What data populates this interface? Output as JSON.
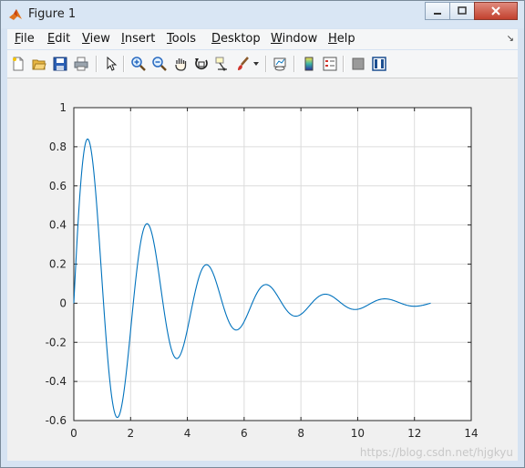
{
  "window": {
    "title": "Figure 1"
  },
  "menu": [
    {
      "id": "file",
      "label": "File"
    },
    {
      "id": "edit",
      "label": "Edit"
    },
    {
      "id": "view",
      "label": "View"
    },
    {
      "id": "insert",
      "label": "Insert"
    },
    {
      "id": "tools",
      "label": "Tools"
    },
    {
      "id": "desktop",
      "label": "Desktop"
    },
    {
      "id": "window",
      "label": "Window"
    },
    {
      "id": "help",
      "label": "Help"
    }
  ],
  "toolbar": [
    "new-figure-icon",
    "open-file-icon",
    "save-icon",
    "print-icon",
    "select-arrow-icon",
    "zoom-in-icon",
    "zoom-out-icon",
    "pan-hand-icon",
    "rotate-3d-icon",
    "data-cursor-icon",
    "brush-icon",
    "link-plot-icon",
    "colorbar-icon",
    "legend-icon",
    "hide-plot-tools-icon",
    "show-plot-tools-icon"
  ],
  "colors": {
    "line": "#0072bd",
    "grid": "#dcdcdc",
    "axes_bg": "#ffffff",
    "figure_bg": "#f0f0f0"
  },
  "chart_data": {
    "type": "line",
    "function": "damped sinusoid, amplitude ~0.85 decaying, period ~2.1",
    "x_range": [
      0,
      12.57
    ],
    "xlim": [
      0,
      14
    ],
    "ylim": [
      -0.6,
      1
    ],
    "xticks": [
      "0",
      "2",
      "4",
      "6",
      "8",
      "10",
      "12",
      "14"
    ],
    "yticks": [
      "1",
      "0.8",
      "0.6",
      "0.4",
      "0.2",
      "0",
      "-0.2",
      "-0.4",
      "-0.6"
    ],
    "grid": true,
    "peaks": [
      {
        "x": 0.5,
        "y": 0.84
      },
      {
        "x": 1.55,
        "y": -0.59
      },
      {
        "x": 2.6,
        "y": 0.42
      },
      {
        "x": 3.6,
        "y": -0.29
      },
      {
        "x": 4.65,
        "y": 0.21
      },
      {
        "x": 5.7,
        "y": -0.14
      },
      {
        "x": 6.75,
        "y": 0.1
      },
      {
        "x": 7.8,
        "y": -0.07
      },
      {
        "x": 8.85,
        "y": 0.05
      },
      {
        "x": 9.9,
        "y": -0.035
      },
      {
        "x": 10.95,
        "y": 0.025
      },
      {
        "x": 12.0,
        "y": -0.015
      },
      {
        "x": 12.57,
        "y": 0.0
      }
    ]
  },
  "watermark": "https://blog.csdn.net/hjgkyu"
}
